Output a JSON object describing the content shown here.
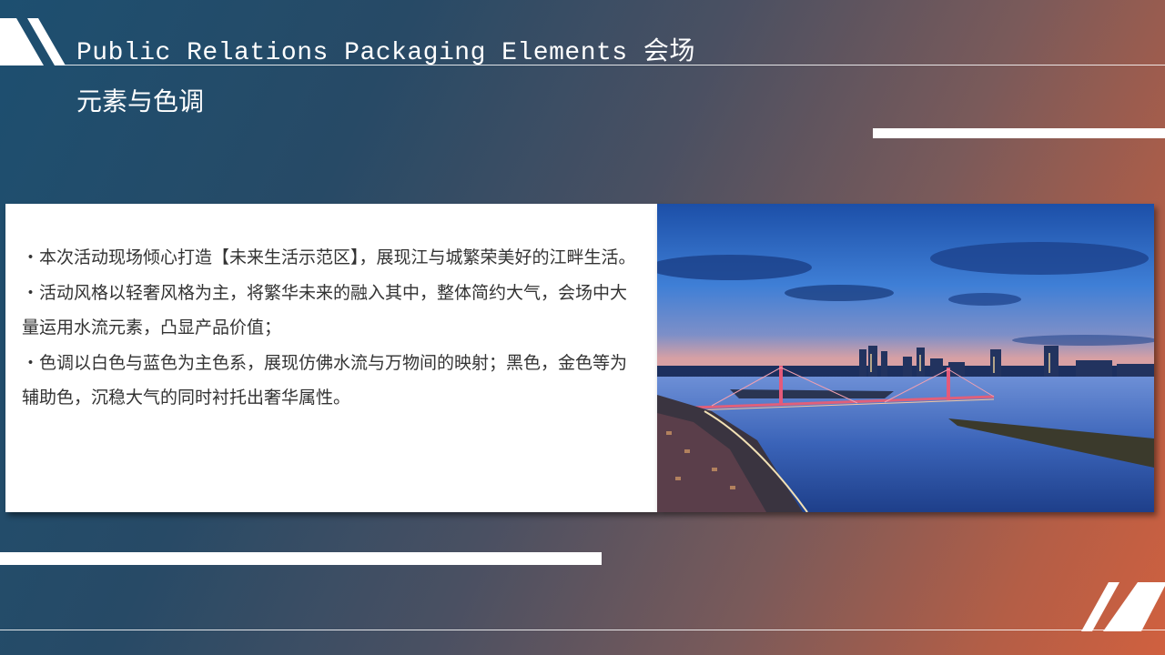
{
  "title": {
    "line1_en": "Public Relations Packaging Elements",
    "line1_cn": "会场",
    "line2": "元素与色调"
  },
  "body": {
    "bullets": [
      "・本次活动现场倾心打造【未来生活示范区】，展现江与城繁荣美好的江畔生活。",
      "・活动风格以轻奢风格为主，将繁华未来的融入其中，整体简约大气，会场中大量运用水流元素，凸显产品价值；",
      "・色调以白色与蓝色为主色系，展现仿佛水流与万物间的映射；黑色，金色等为辅助色，沉稳大气的同时衬托出奢华属性。"
    ]
  },
  "colors": {
    "background_left": "#1d4f70",
    "background_right": "#d0603f",
    "card": "#ffffff",
    "text": "#333333"
  }
}
